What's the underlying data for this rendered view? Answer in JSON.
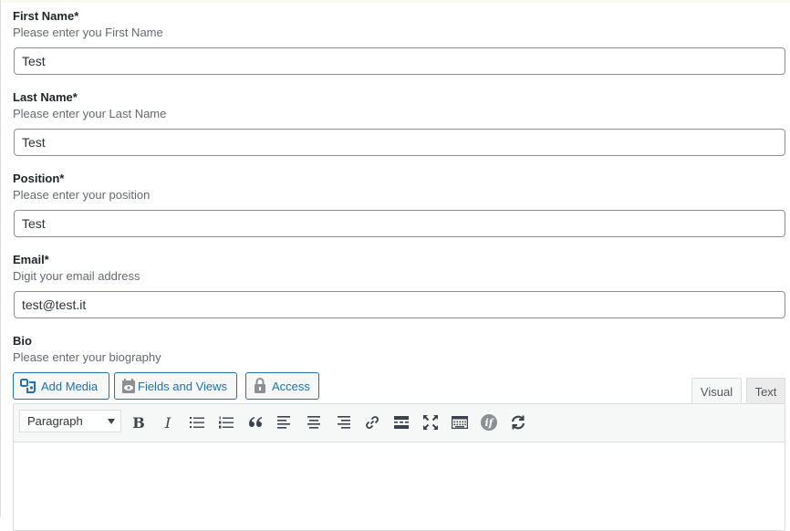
{
  "form": {
    "first_name": {
      "label": "First Name*",
      "description": "Please enter you First Name",
      "value": "Test"
    },
    "last_name": {
      "label": "Last Name*",
      "description": "Please enter your Last Name",
      "value": "Test"
    },
    "position": {
      "label": "Position*",
      "description": "Please enter your position",
      "value": "Test"
    },
    "email": {
      "label": "Email*",
      "description": "Digit your email address",
      "value": "test@test.it"
    },
    "bio": {
      "label": "Bio",
      "description": "Please enter your biography"
    }
  },
  "media_buttons": {
    "add_media": "Add Media",
    "fields_and_views": "Fields and Views",
    "access": "Access"
  },
  "editor_tabs": {
    "visual": "Visual",
    "text": "Text"
  },
  "toolbar": {
    "format_selected": "Paragraph",
    "bold": "B",
    "italic": "I",
    "icons": [
      "bold-icon",
      "italic-icon",
      "bullet-list-icon",
      "numbered-list-icon",
      "blockquote-icon",
      "align-left-icon",
      "align-center-icon",
      "align-right-icon",
      "link-icon",
      "read-more-icon",
      "fullscreen-icon",
      "toolbar-toggle-icon",
      "toolset-conditional-icon",
      "refresh-icon"
    ]
  },
  "colors": {
    "accent": "#2271b1",
    "border": "#8c8f94",
    "toolbar_bg": "#f6f7f7"
  }
}
